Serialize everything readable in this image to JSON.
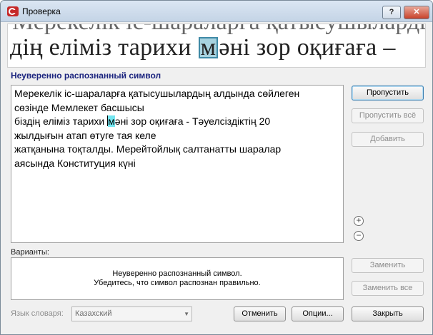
{
  "window": {
    "title": "Проверка",
    "help_label": "?",
    "close_label": "✕"
  },
  "zoom_view": {
    "prev_line": "Мерекелік іс-шараларға қатысушылардың",
    "before": "дің еліміз тарихи ",
    "highlight": "м",
    "after": "әні зор оқиғаға –"
  },
  "section_title": "Неуверенно распознанный символ",
  "editor": {
    "line1": "Мерекелік іс-шараларға қатысушылардың алдында сөйлеген",
    "line2": "сөзінде Мемлекет басшысы",
    "line3_before": "біздің еліміз тарихи ",
    "line3_char": "м",
    "line3_after": "әні зор оқиғаға - Тәуелсіздіктің 20",
    "line4": "жылдығын атап өтуге тая келе",
    "line5": "жатқанына тоқталды. Мерейтойлық салтанатты шаралар",
    "line6": "аясында Конституция күні"
  },
  "side_buttons": {
    "skip": "Пропустить",
    "skip_all": "Пропустить всё",
    "add": "Добавить",
    "replace": "Заменить",
    "replace_all": "Заменить все"
  },
  "zoom_controls": {
    "plus": "+",
    "minus": "−"
  },
  "variants": {
    "label": "Варианты:",
    "message_line1": "Неуверенно распознанный символ.",
    "message_line2": "Убедитесь, что символ распознан правильно."
  },
  "footer": {
    "dict_label": "Язык словаря:",
    "dict_value": "Казахский",
    "cancel": "Отменить",
    "options": "Опции...",
    "close": "Закрыть"
  }
}
